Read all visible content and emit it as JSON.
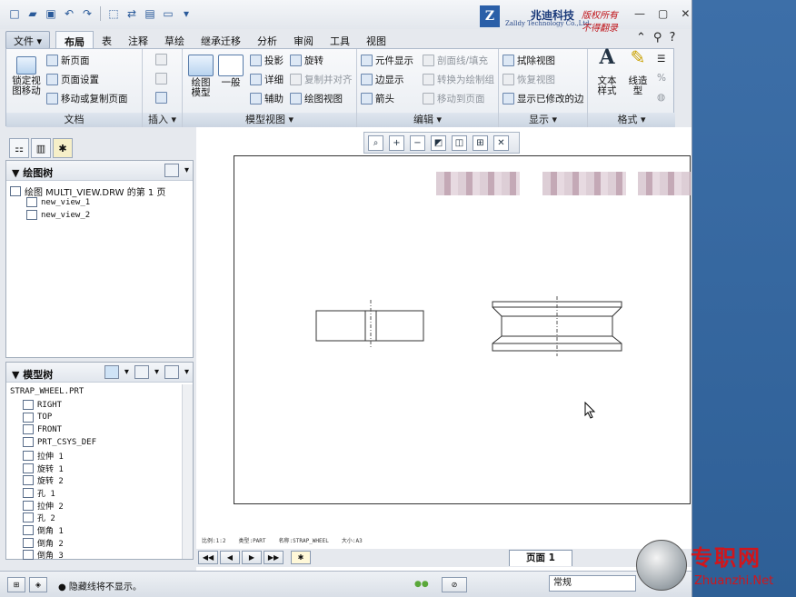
{
  "logo": {
    "mark": "Z",
    "name_cn": "兆迪科技",
    "name_en": "Zalldy Technology Co.,Ltd.",
    "slogan1": "版权所有",
    "slogan2": "不得翻录"
  },
  "menu": {
    "file": "文件",
    "tabs": [
      "布局",
      "表",
      "注释",
      "草绘",
      "继承迁移",
      "分析",
      "审阅",
      "工具",
      "视图"
    ],
    "active_tab": "布局"
  },
  "ribbon": {
    "doc": {
      "label": "文档",
      "lock_view": "锁定视\n图移动",
      "new_page": "新页面",
      "page_setup": "页面设置",
      "move_copy": "移动或复制页面"
    },
    "insert": {
      "label": "插入"
    },
    "model_view": {
      "label": "模型视图",
      "drawing_model": "绘图\n模型",
      "general": "一般",
      "projection": "投影",
      "detail": "详细",
      "auxiliary": "辅助",
      "revolve": "旋转",
      "copy_align": "复制并对齐",
      "drawing_view": "绘图视图"
    },
    "edit": {
      "label": "编辑",
      "element_display": "元件显示",
      "edge_display": "边显示",
      "arrow": "箭头",
      "section_fill": "剖面线/填充",
      "convert_sketch": "转换为绘制组",
      "move_to_page": "移动到页面"
    },
    "display": {
      "label": "显示",
      "erase_view": "拭除视图",
      "restore_view": "恢复视图",
      "show_modified_edges": "显示已修改的边"
    },
    "format": {
      "label": "格式",
      "text_style": "文本\n样式",
      "line_style": "线造\n型"
    }
  },
  "drawing_tree": {
    "title": "绘图树",
    "root": "绘图 MULTI_VIEW.DRW 的第 1 页",
    "items": [
      "new_view_1",
      "new_view_2"
    ]
  },
  "model_tree": {
    "title": "模型树",
    "root": "STRAP_WHEEL.PRT",
    "items": [
      "RIGHT",
      "TOP",
      "FRONT",
      "PRT_CSYS_DEF",
      "拉伸 1",
      "旋转 1",
      "旋转 2",
      "孔 1",
      "拉伸 2",
      "孔 2",
      "倒角 1",
      "倒角 2",
      "倒角 3"
    ]
  },
  "sheet_status": [
    "比例:1:2",
    "类型:PART",
    "名称:STRAP_WHEEL",
    "大小:A3"
  ],
  "pagenav": {
    "page_label": "页面 1"
  },
  "status": {
    "message": "隐藏线将不显示。",
    "filter": "常规"
  },
  "watermark": {
    "cn": "专职网",
    "en": "Zhuanzhi.Net"
  },
  "colors": {
    "desktop": "#3a6ea5",
    "accent_red": "#d0161c"
  }
}
